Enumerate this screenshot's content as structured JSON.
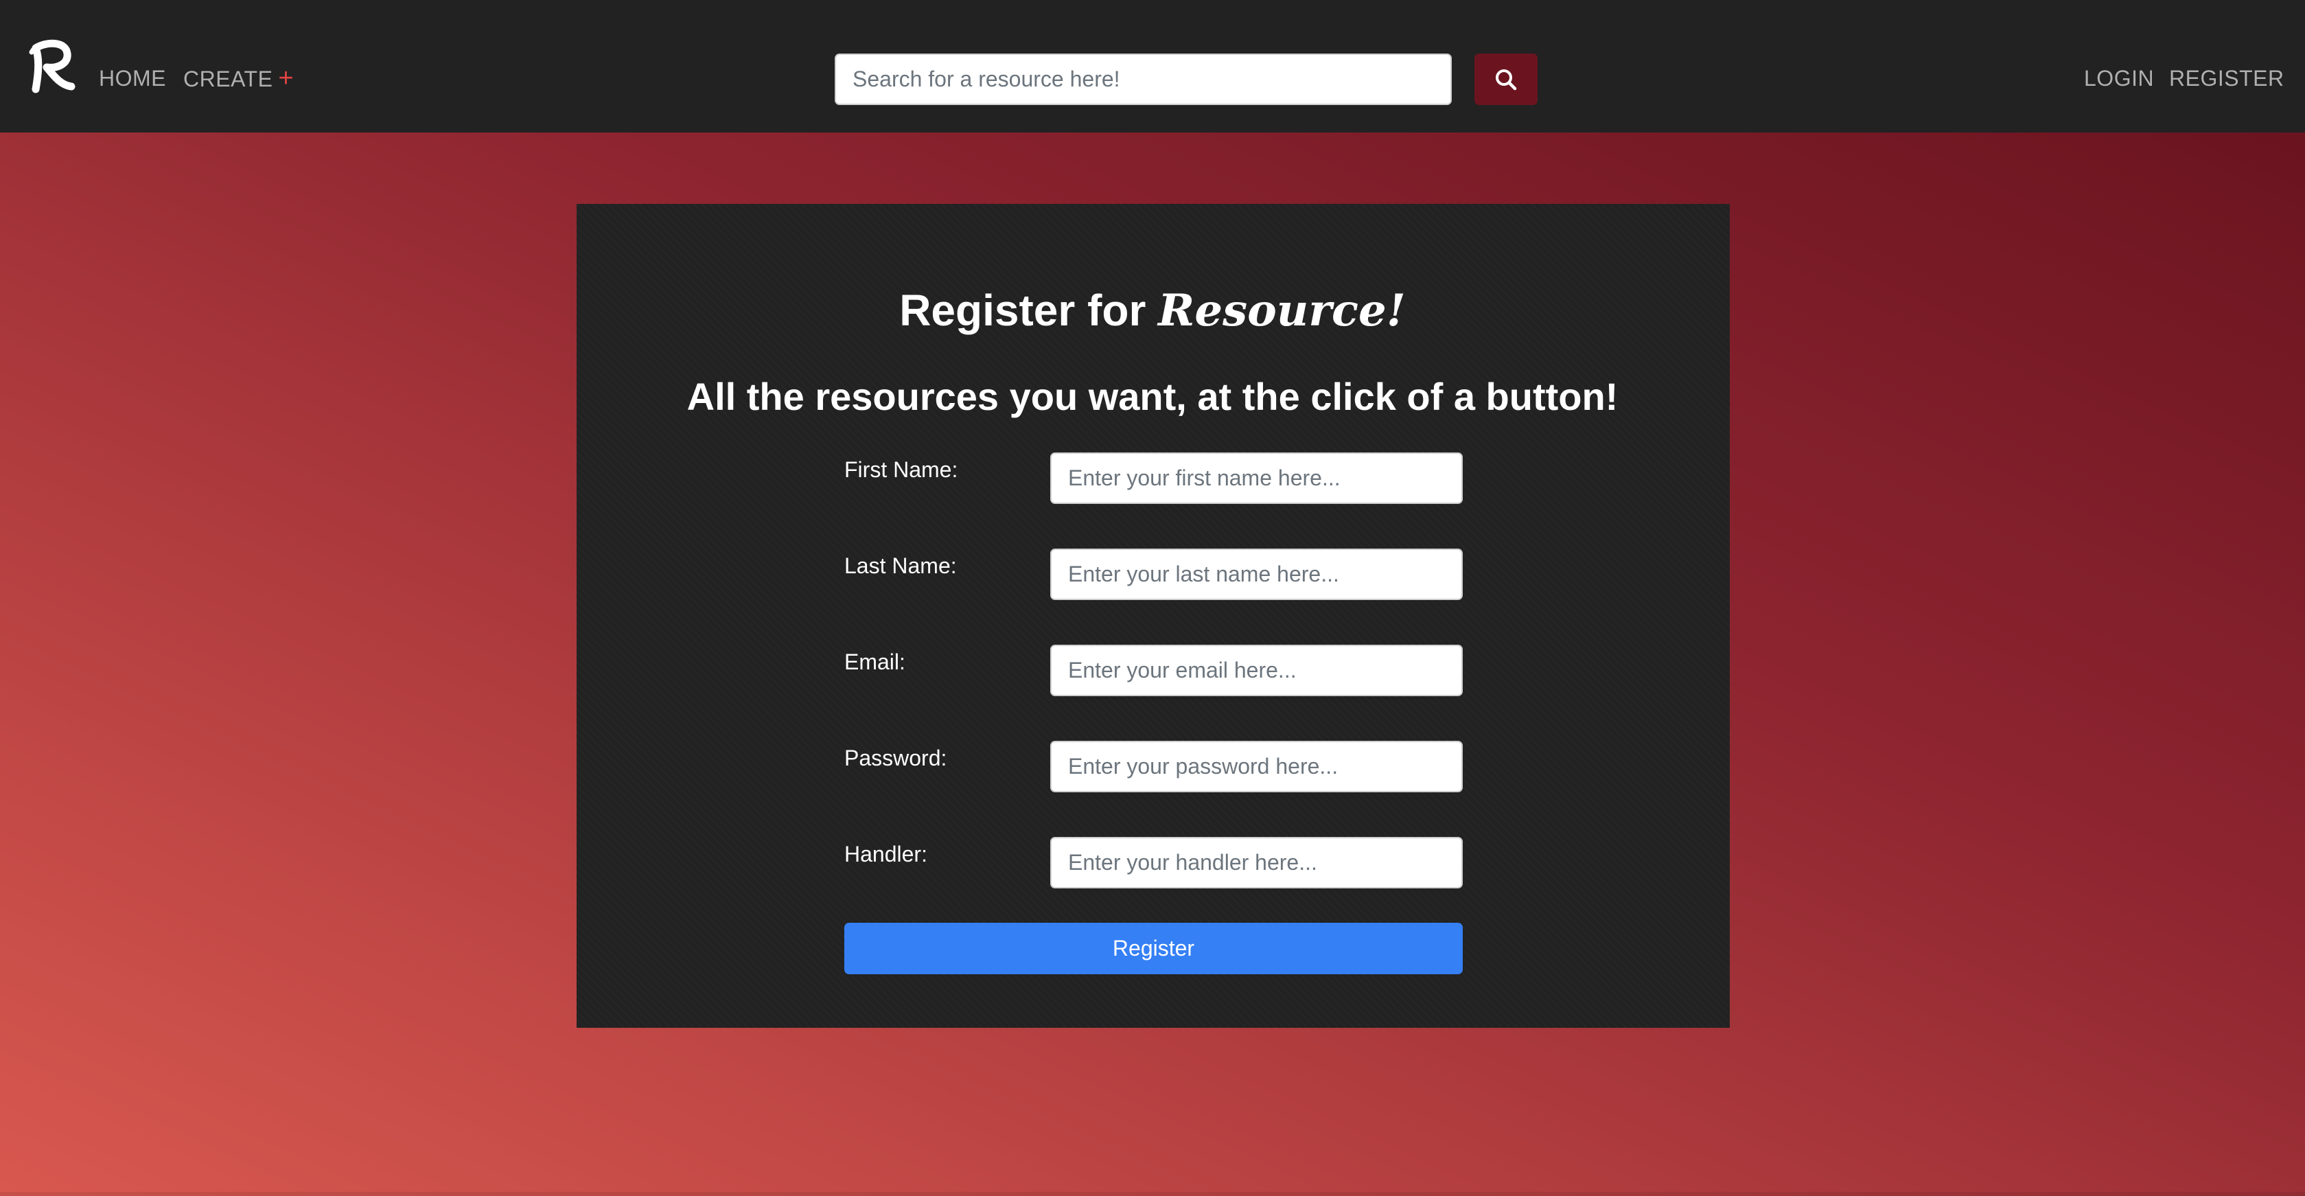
{
  "navbar": {
    "brand_icon": "resource-logo-r-icon",
    "home_label": "HOME",
    "create_label": "CREATE",
    "create_plus": "+",
    "login_label": "LOGIN",
    "register_label": "REGISTER",
    "search": {
      "placeholder": "Search for a resource here!",
      "value": "",
      "button_icon": "magnifier-search-icon"
    }
  },
  "form": {
    "title_prefix": "Register for",
    "title_brand": "Resource!",
    "subtitle": "All the resources you want, at the click of a button!",
    "fields": [
      {
        "label": "First Name:",
        "placeholder": "Enter your first name here...",
        "value": ""
      },
      {
        "label": "Last Name:",
        "placeholder": "Enter your last name here...",
        "value": ""
      },
      {
        "label": "Email:",
        "placeholder": "Enter your email here...",
        "value": ""
      },
      {
        "label": "Password:",
        "placeholder": "Enter your password here...",
        "value": ""
      },
      {
        "label": "Handler:",
        "placeholder": "Enter your handler here...",
        "value": ""
      }
    ],
    "submit_label": "Register"
  },
  "colors": {
    "navbar_bg": "#222222",
    "search_button_bg": "#6b1420",
    "card_bg": "#222222",
    "submit_bg": "#3580f5",
    "gradient_light": "#d8584f",
    "gradient_dark": "#6a1420",
    "accent_plus": "#e04444"
  }
}
